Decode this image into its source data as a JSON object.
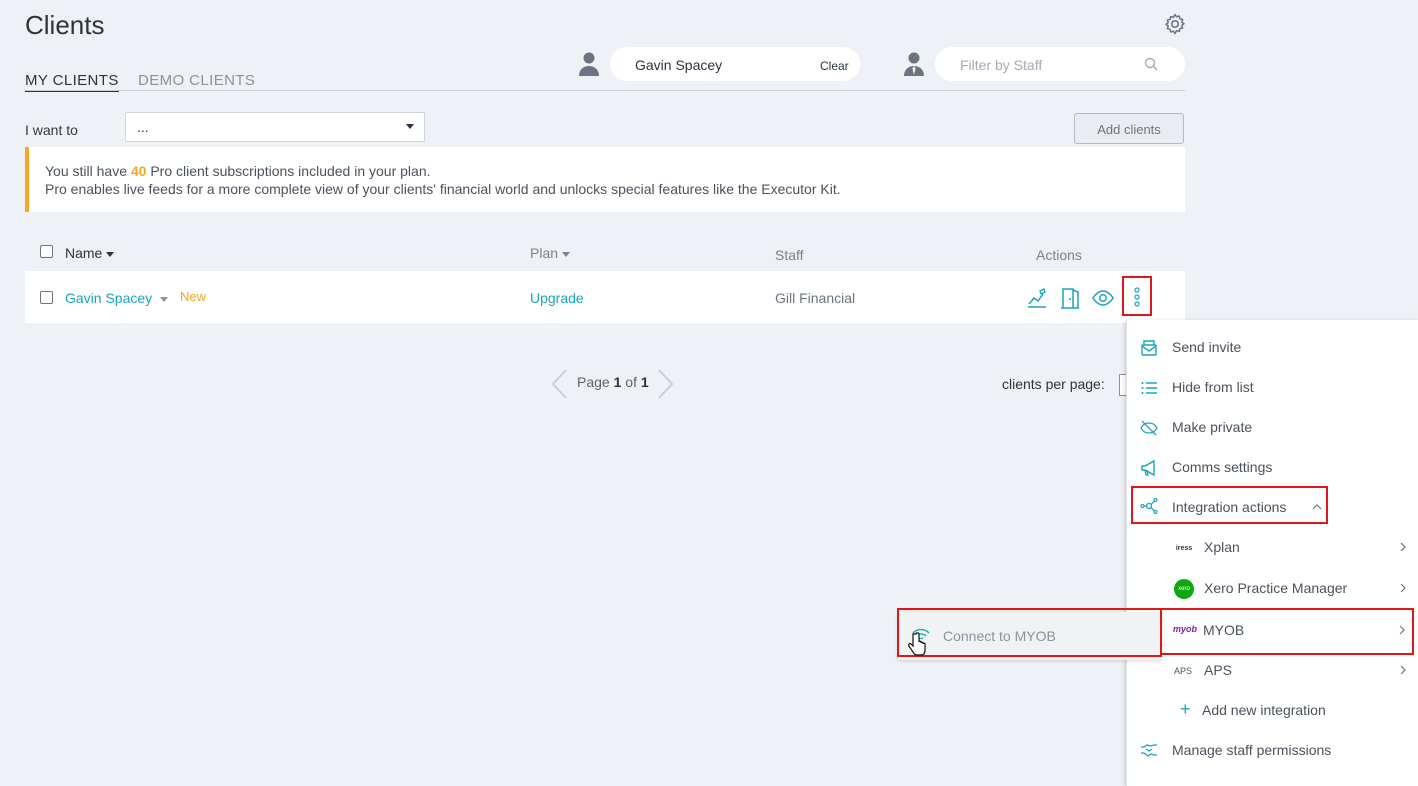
{
  "page": {
    "title": "Clients"
  },
  "tabs": [
    {
      "label": "MY CLIENTS",
      "active": true
    },
    {
      "label": "DEMO CLIENTS",
      "active": false
    }
  ],
  "client_filter": {
    "value": "Gavin Spacey",
    "clear_label": "Clear"
  },
  "staff_filter": {
    "placeholder": "Filter by Staff"
  },
  "toolbar": {
    "i_want_to_label": "I want to",
    "select_value": "...",
    "add_clients_label": "Add clients"
  },
  "banner": {
    "line1_prefix": "You still have ",
    "count": "40",
    "line1_suffix": " Pro client subscriptions included in your plan.",
    "line2": "Pro enables live feeds for a more complete view of your clients' financial world and unlocks special features like the Executor Kit."
  },
  "table": {
    "headers": {
      "name": "Name",
      "plan": "Plan",
      "staff": "Staff",
      "actions": "Actions"
    },
    "rows": [
      {
        "name": "Gavin Spacey",
        "badge": "New",
        "plan": "Upgrade",
        "staff": "Gill Financial"
      }
    ]
  },
  "pagination": {
    "page_label": "Page",
    "current": "1",
    "of_label": "of",
    "total": "1",
    "per_page_label": "clients per page:"
  },
  "actions_menu": {
    "items": [
      {
        "label": "Send invite",
        "icon": "envelope-icon"
      },
      {
        "label": "Hide from list",
        "icon": "list-icon"
      },
      {
        "label": "Make private",
        "icon": "eye-slash-icon"
      },
      {
        "label": "Comms settings",
        "icon": "megaphone-icon"
      },
      {
        "label": "Integration actions",
        "icon": "network-icon"
      }
    ],
    "integrations": [
      {
        "label": "Xplan",
        "logo_text": "iress"
      },
      {
        "label": "Xero Practice Manager",
        "logo_text": "xero"
      },
      {
        "label": "MYOB",
        "logo_text": "myob"
      },
      {
        "label": "APS",
        "logo_text": "APS"
      }
    ],
    "add_integration": "Add new integration",
    "manage_permissions": "Manage staff permissions"
  },
  "myob_submenu": {
    "connect_label": "Connect to MYOB"
  },
  "colors": {
    "accent": "#1aa3c0",
    "highlight": "#f5a623",
    "annotation": "#e0161b",
    "xero_green": "#13b5ea"
  }
}
